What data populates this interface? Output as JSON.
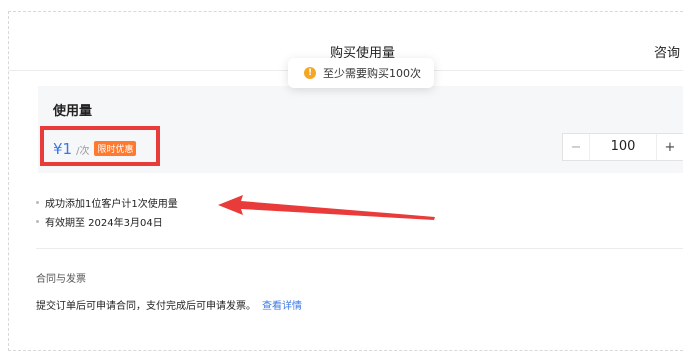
{
  "header": {
    "title": "购买使用量",
    "right_text": "咨询"
  },
  "toast": {
    "icon": "warning-icon",
    "message": "至少需要购买100次"
  },
  "usage": {
    "title": "使用量",
    "price": "¥1",
    "unit": "/次",
    "badge": "限时优惠"
  },
  "quantity": {
    "minus": "−",
    "value": "100",
    "plus": "+"
  },
  "notes": [
    "成功添加1位客户计1次使用量",
    "有效期至 2024年3月04日"
  ],
  "contract": {
    "title": "合同与发票",
    "text": "提交订单后可申请合同，支付完成后可申请发票。",
    "link": "查看详情"
  },
  "colors": {
    "accent": "#3b78e7",
    "badge": "#ff7a2f",
    "annotation_red": "#ea3b3b",
    "warning": "#f5a623"
  }
}
